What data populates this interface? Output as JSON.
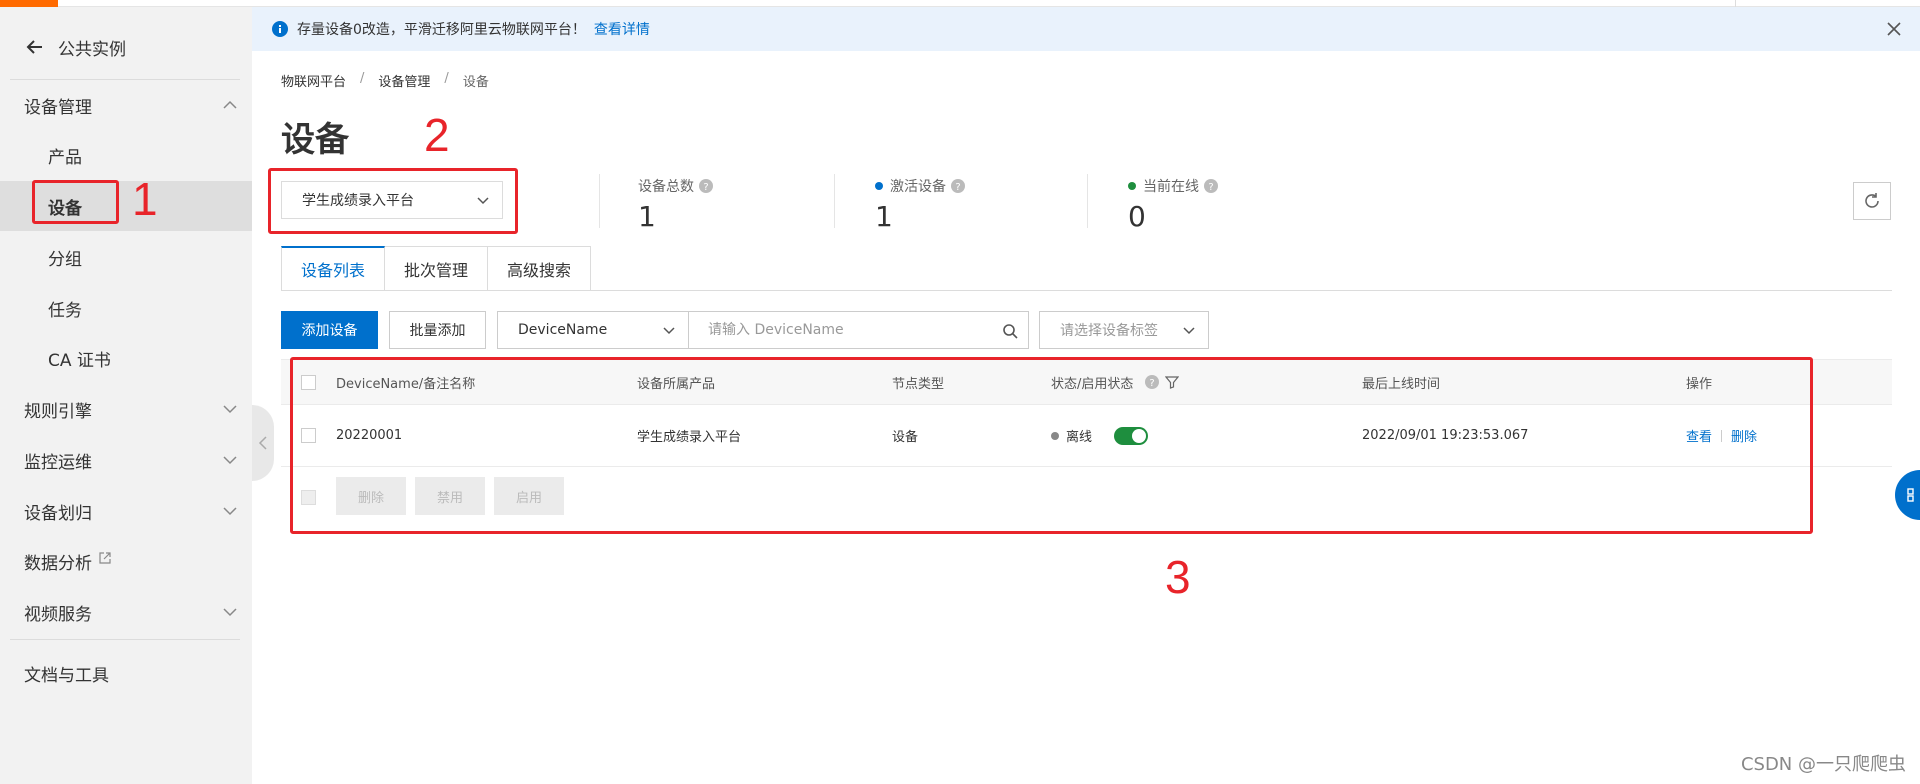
{
  "sidebar": {
    "back_label": "公共实例",
    "items": [
      {
        "label": "设备管理"
      },
      {
        "label": "产品"
      },
      {
        "label": "设备"
      },
      {
        "label": "分组"
      },
      {
        "label": "任务"
      },
      {
        "label": "CA 证书"
      },
      {
        "label": "规则引擎"
      },
      {
        "label": "监控运维"
      },
      {
        "label": "设备划归"
      },
      {
        "label": "数据分析"
      },
      {
        "label": "视频服务"
      },
      {
        "label": "文档与工具"
      }
    ]
  },
  "notice": {
    "text": "存量设备0改造，平滑迁移阿里云物联网平台！",
    "link": "查看详情"
  },
  "breadcrumb": [
    "物联网平台",
    "设备管理",
    "设备"
  ],
  "page_title": "设备",
  "product_select": {
    "value": "学生成绩录入平台"
  },
  "stats": [
    {
      "label": "设备总数",
      "value": "1"
    },
    {
      "label": "激活设备",
      "value": "1",
      "dot_color": "#0070cc"
    },
    {
      "label": "当前在线",
      "value": "0",
      "dot_color": "#1e8e3e"
    }
  ],
  "tabs": [
    "设备列表",
    "批次管理",
    "高级搜索"
  ],
  "toolbar": {
    "add_device": "添加设备",
    "batch_add": "批量添加",
    "field_select": "DeviceName",
    "search_placeholder": "请输入 DeviceName",
    "tag_placeholder": "请选择设备标签"
  },
  "table": {
    "headers": [
      "DeviceName/备注名称",
      "设备所属产品",
      "节点类型",
      "状态/启用状态",
      "最后上线时间",
      "操作"
    ],
    "rows": [
      {
        "device_name": "20220001",
        "product": "学生成绩录入平台",
        "node_type": "设备",
        "status": "离线",
        "enabled": true,
        "last_online": "2022/09/01 19:23:53.067",
        "actions": [
          "查看",
          "删除"
        ]
      }
    ],
    "footer_buttons": [
      "删除",
      "禁用",
      "启用"
    ]
  },
  "annotations": [
    "1",
    "2",
    "3"
  ],
  "watermark": "CSDN @一只爬爬虫",
  "colors": {
    "accent": "#ff6a00",
    "primary": "#0070cc",
    "annotation": "#e8242a",
    "toggle_on": "#1e8e3e"
  }
}
